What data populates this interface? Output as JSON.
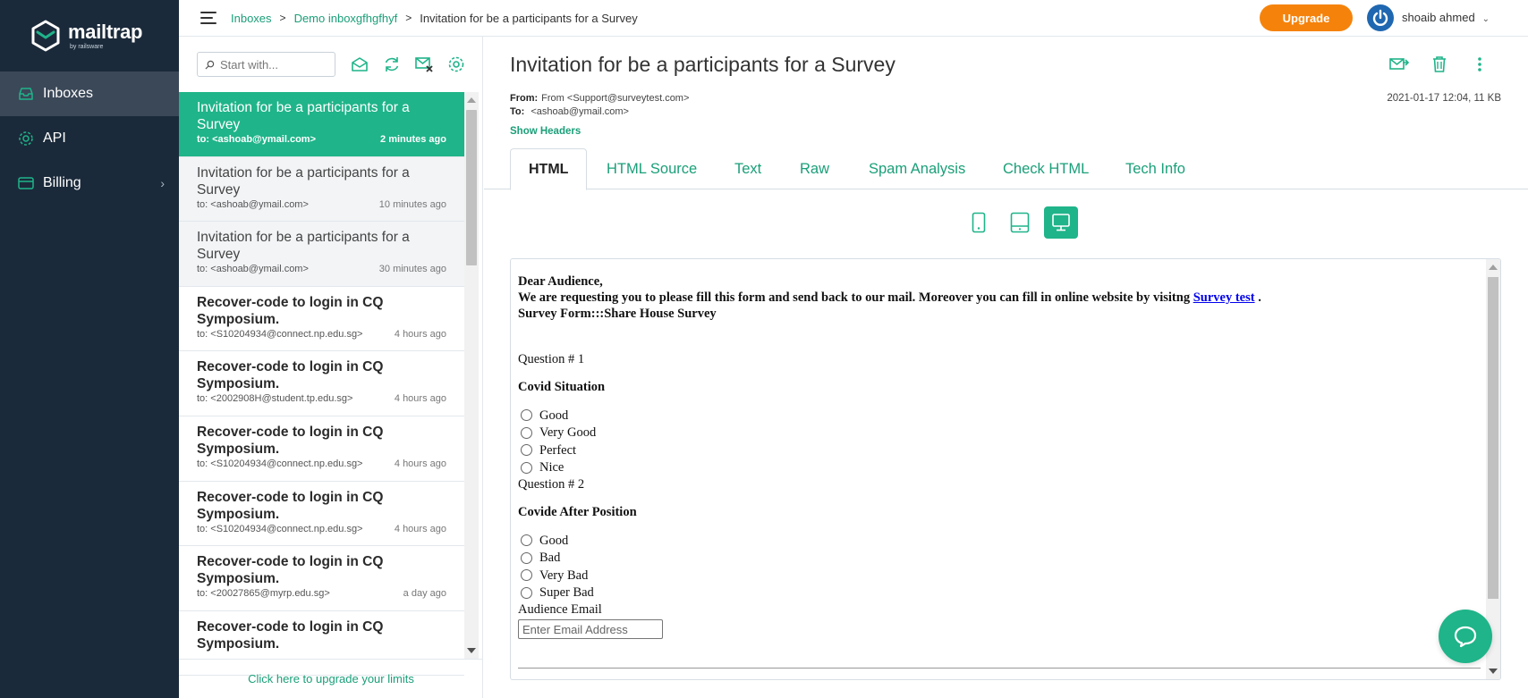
{
  "brand": {
    "name": "mailtrap",
    "sub": "by railsware"
  },
  "sidebar": {
    "items": [
      {
        "label": "Inboxes",
        "icon": "inbox-icon",
        "active": true
      },
      {
        "label": "API",
        "icon": "gear-icon",
        "active": false
      },
      {
        "label": "Billing",
        "icon": "card-icon",
        "active": false,
        "has_submenu": true
      }
    ]
  },
  "header": {
    "breadcrumb": [
      "Inboxes",
      "Demo inboxgfhgfhyf",
      "Invitation for be a participants for a Survey"
    ],
    "upgrade_label": "Upgrade",
    "user_name": "shoaib ahmed"
  },
  "list": {
    "search_placeholder": "Start with...",
    "toolbar_icons": [
      "mark-read-icon",
      "refresh-icon",
      "clear-inbox-icon",
      "settings-icon"
    ],
    "messages": [
      {
        "subject": "Invitation for be a participants for a Survey",
        "to": "to: <ashoab@ymail.com>",
        "time": "2 minutes ago",
        "state": "active"
      },
      {
        "subject": "Invitation for be a participants for a Survey",
        "to": "to: <ashoab@ymail.com>",
        "time": "10 minutes ago",
        "state": "read"
      },
      {
        "subject": "Invitation for be a participants for a Survey",
        "to": "to: <ashoab@ymail.com>",
        "time": "30 minutes ago",
        "state": "read"
      },
      {
        "subject": "Recover-code to login in CQ Symposium.",
        "to": "to: <S10204934@connect.np.edu.sg>",
        "time": "4 hours ago",
        "state": "unread"
      },
      {
        "subject": "Recover-code to login in CQ Symposium.",
        "to": "to: <2002908H@student.tp.edu.sg>",
        "time": "4 hours ago",
        "state": "unread"
      },
      {
        "subject": "Recover-code to login in CQ Symposium.",
        "to": "to: <S10204934@connect.np.edu.sg>",
        "time": "4 hours ago",
        "state": "unread"
      },
      {
        "subject": "Recover-code to login in CQ Symposium.",
        "to": "to: <S10204934@connect.np.edu.sg>",
        "time": "4 hours ago",
        "state": "unread"
      },
      {
        "subject": "Recover-code to login in CQ Symposium.",
        "to": "to: <20027865@myrp.edu.sg>",
        "time": "a day ago",
        "state": "unread"
      },
      {
        "subject": "Recover-code to login in CQ Symposium.",
        "to": "",
        "time": "",
        "state": "unread"
      }
    ],
    "upgrade_link": "Click here to upgrade your limits"
  },
  "message": {
    "subject": "Invitation for be a participants for a Survey",
    "from_label": "From:",
    "from_value": "From <Support@surveytest.com>",
    "to_label": "To:",
    "to_value": "<ashoab@ymail.com>",
    "show_headers": "Show Headers",
    "date_size": "2021-01-17 12:04, 11 KB",
    "tabs": [
      "HTML",
      "HTML Source",
      "Text",
      "Raw",
      "Spam Analysis",
      "Check HTML",
      "Tech Info"
    ],
    "active_tab": "HTML"
  },
  "email": {
    "greeting": "Dear Audience,",
    "intro": "We are requesting you to please fill this form and send back to our mail. Moreover you can fill in online website by visitng",
    "link_text": "Survey test",
    "intro_end": " .",
    "form_title": "Survey Form:::Share House Survey",
    "q1_label": "Question # 1",
    "q1_title": "Covid Situation",
    "q1_options": [
      "Good",
      "Very Good",
      "Perfect",
      "Nice"
    ],
    "q2_label": "Question # 2",
    "q2_title": "Covide After Position",
    "q2_options": [
      "Good",
      "Bad",
      "Very Bad",
      "Super Bad"
    ],
    "email_label": "Audience Email",
    "email_placeholder": "Enter Email Address"
  },
  "colors": {
    "accent": "#1fb489",
    "sidebar_bg": "#1b2a3a",
    "upgrade": "#f5830b",
    "link": "#1a9f78"
  }
}
